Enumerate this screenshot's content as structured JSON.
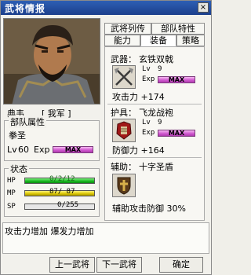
{
  "window": {
    "title": "武将情报",
    "close_label": "×"
  },
  "general": {
    "name": "典韦",
    "army": "[ 我军 ]"
  },
  "tabs": [
    {
      "label": "武将列传"
    },
    {
      "label": "部队特性"
    },
    {
      "label": "能力"
    },
    {
      "label": "装备"
    },
    {
      "label": "策略"
    }
  ],
  "unit": {
    "section_title": "部队属性",
    "troop_type": "拳圣",
    "level_label": "Lv",
    "level": "60",
    "exp_label": "Exp",
    "exp_max_label": "MAX",
    "exp_max_fraction": 1.0
  },
  "status": {
    "section_title": "状态",
    "hp_label": "HP",
    "hp_value": "0/2/12",
    "hp_fraction": 1.0,
    "mp_label": "MP",
    "mp_value": "87/ 87",
    "mp_fraction": 1.0,
    "sp_label": "SP",
    "sp_value": "0/255",
    "sp_fraction": 0.0
  },
  "weapon": {
    "slot_label": "武器：",
    "name": "玄铁双戟",
    "icon": "crossed-halberds-icon",
    "level_label": "Lv",
    "level": "9",
    "exp_label": "Exp",
    "exp_max_label": "MAX",
    "stat_text": "攻击力 +174"
  },
  "armor": {
    "slot_label": "护具：",
    "name": "飞龙战袍",
    "icon": "armor-icon",
    "level_label": "Lv",
    "level": "9",
    "exp_label": "Exp",
    "exp_max_label": "MAX",
    "stat_text": "防御力 +164"
  },
  "accessory": {
    "slot_label": "辅助：",
    "name": "十字圣盾",
    "icon": "cross-shield-icon",
    "stat_text": "辅助攻击防御 30%"
  },
  "description": "攻击力增加 爆发力增加",
  "buttons": {
    "prev": "上一武将",
    "next": "下一武将",
    "ok": "确定"
  },
  "colors": {
    "titlebar": "#1c3f8c",
    "hp": "#1bbf22",
    "mp": "#d2c200",
    "max_bar": "#c74cc7"
  }
}
